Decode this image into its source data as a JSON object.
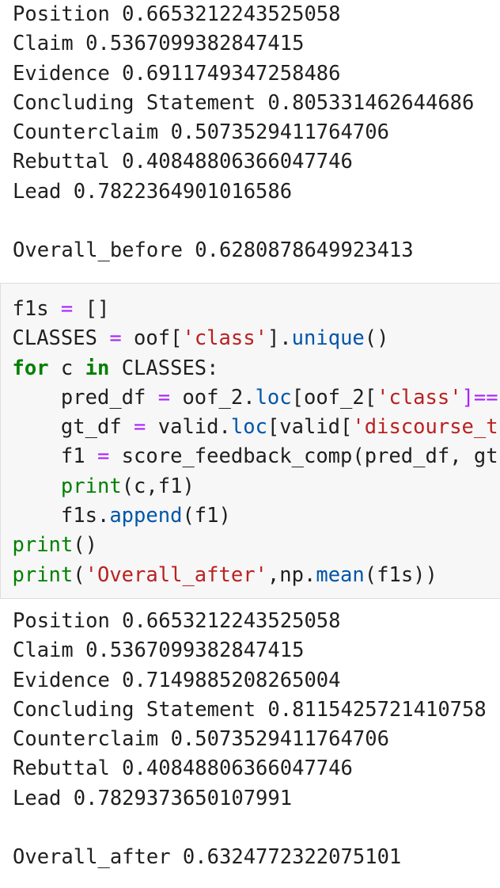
{
  "output_before": {
    "lines": [
      "Position 0.6653212243525058",
      "Claim 0.5367099382847415",
      "Evidence 0.6911749347258486",
      "Concluding Statement 0.805331462644686",
      "Counterclaim 0.5073529411764706",
      "Rebuttal 0.40848806366047746",
      "Lead 0.7822364901016586"
    ],
    "overall": "Overall_before 0.6280878649923413"
  },
  "code": {
    "l1": {
      "a": "f1s",
      "b": "=",
      "c": "[]"
    },
    "l2": {
      "a": "CLASSES",
      "b": "=",
      "c": "oof[",
      "d": "'class'",
      "e": "].",
      "f": "unique",
      "g": "()"
    },
    "l3": {
      "a": "for",
      "b": " c ",
      "c": "in",
      "d": " CLASSES:"
    },
    "l4": {
      "a": "    pred_df ",
      "b": "=",
      "c": " oof_2.",
      "d": "loc",
      "e": "[oof_2[",
      "f": "'class'",
      "g": "]=="
    },
    "l5": {
      "a": "    gt_df ",
      "b": "=",
      "c": " valid.",
      "d": "loc",
      "e": "[valid[",
      "f": "'discourse_t"
    },
    "l6": {
      "a": "    f1 ",
      "b": "=",
      "c": " score_feedback_comp(pred_df, gt"
    },
    "l7": {
      "a": "    ",
      "b": "print",
      "c": "(c,f1)"
    },
    "l8": {
      "a": "    f1s.",
      "b": "append",
      "c": "(f1)"
    },
    "l9": {
      "a": "print",
      "b": "()"
    },
    "l10": {
      "a": "print",
      "b": "(",
      "c": "'Overall_after'",
      "d": ",np.",
      "e": "mean",
      "f": "(f1s))"
    }
  },
  "output_after": {
    "lines": [
      "Position 0.6653212243525058",
      "Claim 0.5367099382847415",
      "Evidence 0.7149885208265004",
      "Concluding Statement 0.8115425721410758",
      "Counterclaim 0.5073529411764706",
      "Rebuttal 0.40848806366047746",
      "Lead 0.7829373650107991"
    ],
    "overall": "Overall_after 0.6324772322075101"
  },
  "colors": {
    "keyword": "#008000",
    "operator": "#aa22ff",
    "string": "#ba2121",
    "function": "#0055aa",
    "cell_background": "#f7f7f7"
  }
}
